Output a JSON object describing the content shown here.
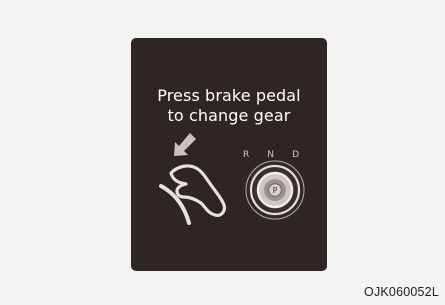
{
  "display": {
    "message_lines": [
      "Press brake pedal",
      "to change gear"
    ],
    "gears": [
      "R",
      "N",
      "D"
    ],
    "center_button": "P"
  },
  "icons": [
    "arrow-down-left-icon",
    "brake-pedal-icon",
    "gear-shift-dial-icon"
  ],
  "caption": "OJK060052L",
  "colors": {
    "background": "#f3f3f3",
    "screen": "#2f2624",
    "text": "#ffffff",
    "icon": "#e6e2e1"
  }
}
